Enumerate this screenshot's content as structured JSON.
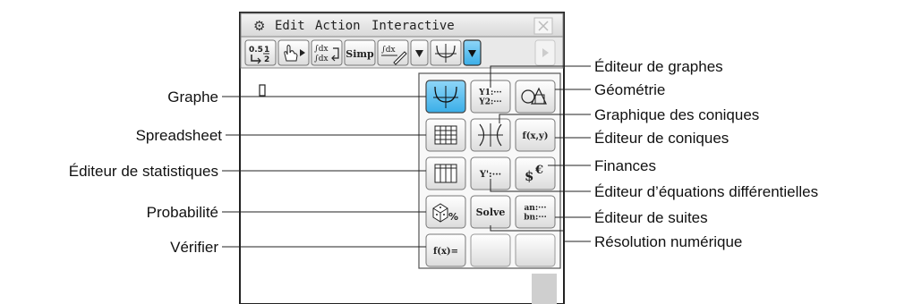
{
  "menu": {
    "gear_icon": "gear-icon",
    "items": [
      "Edit",
      "Action",
      "Interactive"
    ],
    "close_icon": "close-icon"
  },
  "toolbar": {
    "simp_label": "Simp"
  },
  "panel": {
    "button_labels": {
      "graph_equations": "Y1:···\nY2:···",
      "conic_fxy": "f(x,y)",
      "diff_eq": "Y':···",
      "solve": "Solve",
      "sequence": "an:···\nbn:···",
      "verify": "f(x)="
    },
    "selected_color": "#4db8ec"
  },
  "callouts": {
    "left": [
      "Graphe",
      "Spreadsheet",
      "Éditeur de statistiques",
      "Probabilité",
      "Vérifier"
    ],
    "right": [
      "Éditeur de graphes",
      "Géométrie",
      "Graphique des coniques",
      "Éditeur de coniques",
      "Finances",
      "Éditeur d’équations différentielles",
      "Éditeur de suites",
      "Résolution numérique"
    ]
  }
}
